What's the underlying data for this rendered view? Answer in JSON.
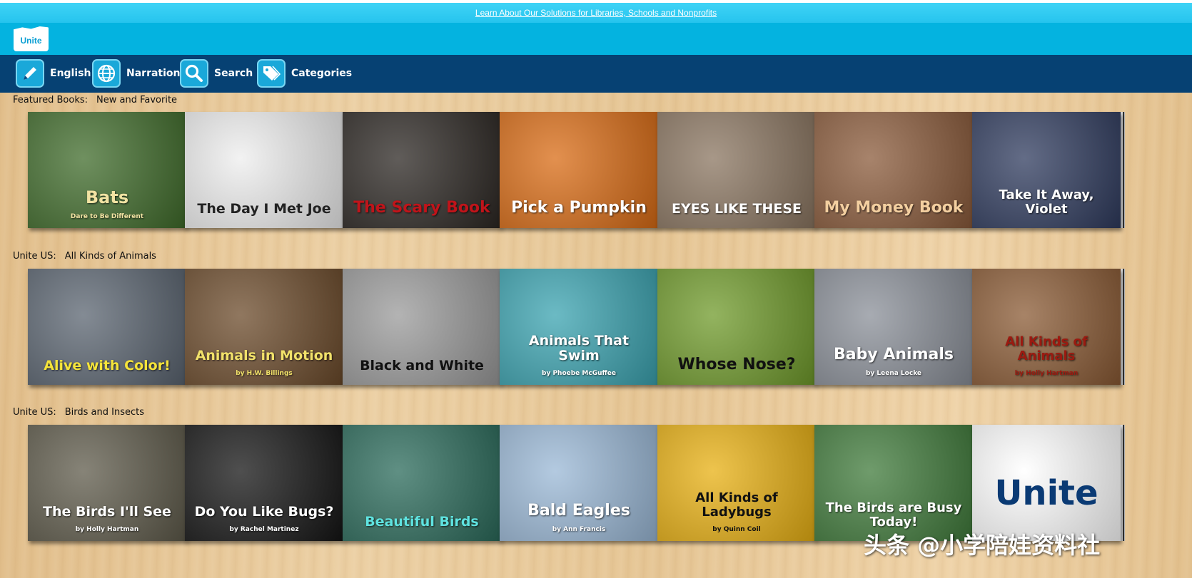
{
  "topbar": {
    "link": "Learn About Our Solutions for Libraries, Schools and Nonprofits"
  },
  "logo": {
    "text": "Unite"
  },
  "nav": [
    {
      "label": "English",
      "icon": "pencil-icon"
    },
    {
      "label": "Narration",
      "icon": "globe-icon"
    },
    {
      "label": "Search",
      "icon": "search-icon"
    },
    {
      "label": "Categories",
      "icon": "tags-icon"
    }
  ],
  "rows": [
    {
      "section": "Featured Books:",
      "subtitle": "New and Favorite",
      "books": [
        {
          "title": "Bats",
          "subtitle": "Dare to Be Different",
          "bg": "#3f6b2a",
          "fg": "#f2e3a3"
        },
        {
          "title": "The Day I Met Joe",
          "subtitle": "",
          "bg": "#eeeeee",
          "fg": "#222222"
        },
        {
          "title": "The Scary Book",
          "subtitle": "",
          "bg": "#2b2622",
          "fg": "#c0141a"
        },
        {
          "title": "Pick a Pumpkin",
          "subtitle": "",
          "bg": "#d96b14",
          "fg": "#ffffff"
        },
        {
          "title": "EYES LIKE THESE",
          "subtitle": "",
          "bg": "#8a7560",
          "fg": "#ffffff"
        },
        {
          "title": "My Money Book",
          "subtitle": "",
          "bg": "#8a5a3a",
          "fg": "#f3cfa0"
        },
        {
          "title": "Take It Away, Violet",
          "subtitle": "",
          "bg": "#2f3b5e",
          "fg": "#ffffff"
        }
      ]
    },
    {
      "section": "Unite US:",
      "subtitle": "All Kinds of Animals",
      "books": [
        {
          "title": "Alive with Color!",
          "subtitle": "",
          "bg": "#5a6470",
          "fg": "#f5e43a"
        },
        {
          "title": "Animals in Motion",
          "subtitle": "by H.W. Billings",
          "bg": "#6b4a2a",
          "fg": "#f1e16a"
        },
        {
          "title": "Black and White",
          "subtitle": "",
          "bg": "#9a9a9a",
          "fg": "#111111"
        },
        {
          "title": "Animals That Swim",
          "subtitle": "by Phoebe McGuffee",
          "bg": "#3aa3b0",
          "fg": "#ffffff"
        },
        {
          "title": "Whose Nose?",
          "subtitle": "",
          "bg": "#6f9a2a",
          "fg": "#111111"
        },
        {
          "title": "Baby Animals",
          "subtitle": "by Leena Locke",
          "bg": "#8a8f98",
          "fg": "#ffffff"
        },
        {
          "title": "All Kinds of Animals",
          "subtitle": "by Holly Hartman",
          "bg": "#8a5a34",
          "fg": "#9b1a10"
        }
      ]
    },
    {
      "section": "Unite US:",
      "subtitle": "Birds and Insects",
      "books": [
        {
          "title": "The Birds I'll See",
          "subtitle": "by Holly Hartman",
          "bg": "#5e5a4a",
          "fg": "#ffffff"
        },
        {
          "title": "Do You Like Bugs?",
          "subtitle": "by Rachel Martinez",
          "bg": "#141414",
          "fg": "#ffffff"
        },
        {
          "title": "Beautiful Birds",
          "subtitle": "",
          "bg": "#2a6a5a",
          "fg": "#5fe3e0"
        },
        {
          "title": "Bald Eagles",
          "subtitle": "by Ann Francis",
          "bg": "#9ab8d6",
          "fg": "#ffffff"
        },
        {
          "title": "All Kinds of Ladybugs",
          "subtitle": "by Quinn Coil",
          "bg": "#e8b012",
          "fg": "#111111"
        },
        {
          "title": "The Birds are Busy Today!",
          "subtitle": "",
          "bg": "#3f7a3a",
          "fg": "#ffffff"
        },
        {
          "title": "Unite",
          "subtitle": "",
          "bg": "#ffffff",
          "fg": "#0a3a74"
        }
      ]
    }
  ],
  "watermark": "头条 @小学陪娃资料社"
}
